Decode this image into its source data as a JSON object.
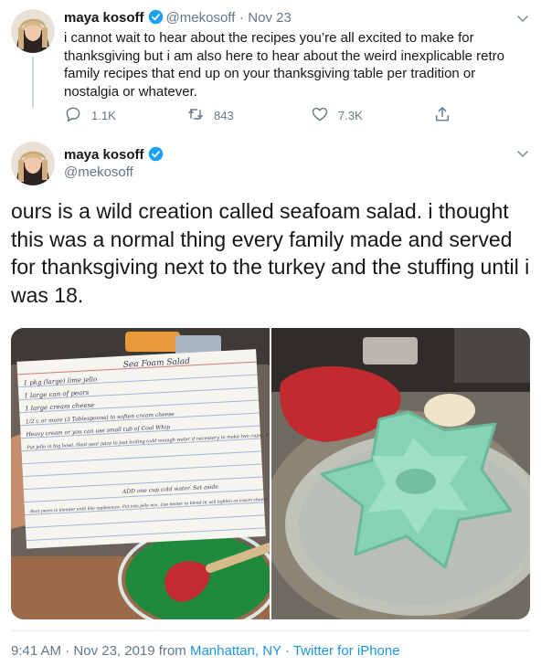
{
  "reply_parent": {
    "display_name": "maya kosoff",
    "handle": "@mekosoff",
    "separator": "·",
    "date": "Nov 23",
    "text": "i cannot wait to hear about the recipes you’re all excited to make for thanksgiving but i am also here to hear about the weird inexplicable retro family recipes that end up on your thanksgiving table per tradition or nostalgia or whatever.",
    "replies": "1.1K",
    "retweets": "843",
    "likes": "7.3K"
  },
  "main_tweet": {
    "display_name": "maya kosoff",
    "handle": "@mekosoff",
    "text": "ours is a wild creation called seafoam salad. i thought this was a normal thing every family made and served for thanksgiving next to the turkey and the stuffing until i was 18.",
    "recipe_card": {
      "title": "Sea Foam Salad",
      "ingredients": [
        "1 pkg (large) lime jello",
        "1 large can of pears",
        "1 large cream cheese",
        "1/2 c or more (3 Tablespoons) to soften cream cheese",
        "Heavy cream or you can use small tub of Cool Whip"
      ],
      "step1": "Put jello in big bowl. Heat pear juice to just boiling (add enough water if necessary to make two cups). Pour over jello dissolve.",
      "step2": "ADD one cup cold water. Set aside.",
      "step3": "Beat pears in blender until like applesauce. Put into jello mix. Use beater to blend (it will lighten as cream cheese goes) with jello as you beat on low speed or medium just to blend"
    },
    "time": "9:41 AM",
    "date": "Nov 23, 2019",
    "from_word": "from",
    "location": "Manhattan, NY",
    "source": "Twitter for iPhone"
  },
  "colors": {
    "text": "#14171a",
    "secondary": "#657786",
    "link": "#1b95e0",
    "verified": "#1da1f2",
    "divider": "#e6ecf0",
    "seafoam": "#86d3b3"
  },
  "icons": [
    "verified-badge-icon",
    "chevron-down-icon",
    "reply-icon",
    "retweet-icon",
    "like-icon",
    "share-icon"
  ]
}
